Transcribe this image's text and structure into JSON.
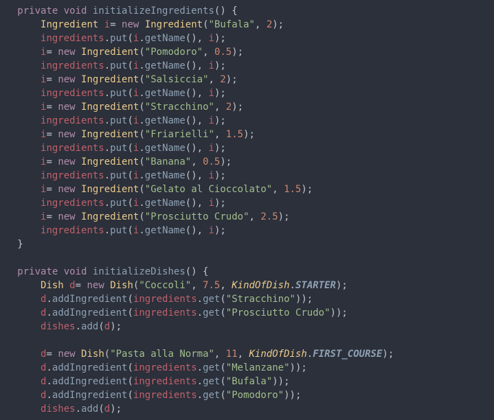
{
  "method1": {
    "modifiers": "private void",
    "name": "initializeIngredients",
    "ingredients": [
      {
        "name": "Bufala",
        "qty": "2"
      },
      {
        "name": "Pomodoro",
        "qty": "0.5"
      },
      {
        "name": "Salsiccia",
        "qty": "2"
      },
      {
        "name": "Stracchino",
        "qty": "2"
      },
      {
        "name": "Friarielli",
        "qty": "1.5"
      },
      {
        "name": "Banana",
        "qty": "0.5"
      },
      {
        "name": "Gelato al Cioccolato",
        "qty": "1.5"
      },
      {
        "name": "Prosciutto Crudo",
        "qty": "2.5"
      }
    ],
    "type": "Ingredient",
    "var": "i",
    "map": "ingredients",
    "put": "put",
    "get": "getName",
    "new": "new"
  },
  "method2": {
    "modifiers": "private void",
    "name": "initializeDishes",
    "type": "Dish",
    "var": "d",
    "new": "new",
    "enum": "KindOfDish",
    "map": "ingredients",
    "list": "dishes",
    "get": "get",
    "add": "add",
    "addIng": "addIngredient",
    "dishes": [
      {
        "name": "Coccoli",
        "price": "7.5",
        "kind": "STARTER",
        "ings": [
          "Stracchino",
          "Prosciutto Crudo"
        ]
      },
      {
        "name": "Pasta alla Norma",
        "price": "11",
        "kind": "FIRST_COURSE",
        "ings": [
          "Melanzane",
          "Bufala",
          "Pomodoro"
        ]
      }
    ]
  }
}
